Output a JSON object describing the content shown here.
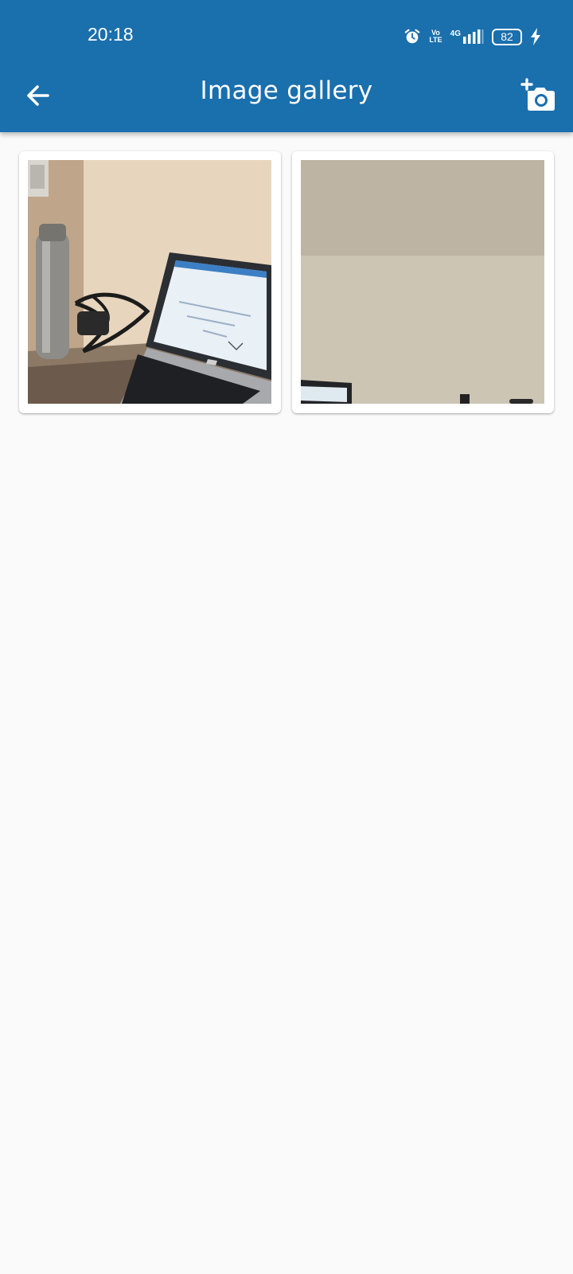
{
  "status_bar": {
    "time": "20:18",
    "volte_top": "Vo",
    "volte_bottom": "LTE",
    "network": "4G",
    "battery": "82"
  },
  "app_bar": {
    "title": "Image gallery",
    "back_icon": "arrow-back-icon",
    "action_icon": "add-a-photo-icon",
    "background": "#1a6fad"
  },
  "gallery": {
    "items": [
      {
        "icon": "photo-thumbnail",
        "subject": "desk with laptop and bottle"
      },
      {
        "icon": "photo-thumbnail",
        "subject": "wall"
      }
    ]
  }
}
